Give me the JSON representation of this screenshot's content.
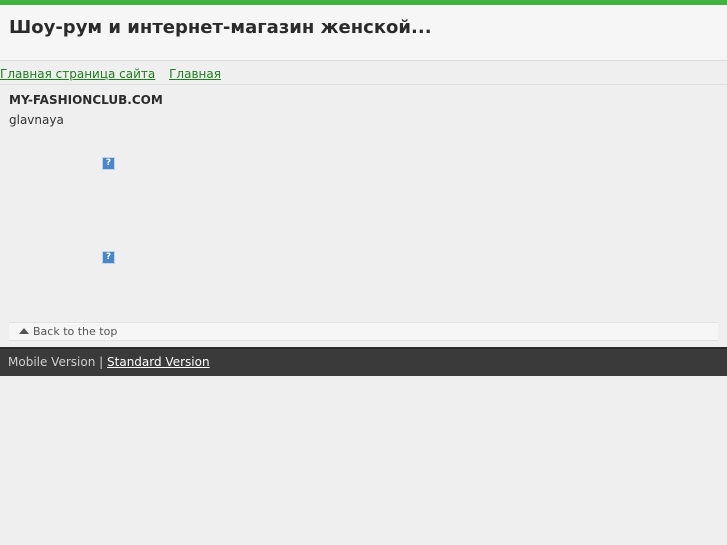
{
  "header": {
    "title": "Шоу-рум и интернет-магазин женской..."
  },
  "breadcrumb": {
    "items": [
      "Главная страница сайта",
      "Главная"
    ]
  },
  "content": {
    "site_name": "MY-FASHIONCLUB.COM",
    "subtitle": "glavnaya",
    "image_placeholder_glyph": "?"
  },
  "back_to_top": {
    "label": "Back to the top"
  },
  "footer": {
    "mobile_label": "Mobile Version",
    "separator": "|",
    "standard_label": "Standard Version"
  },
  "colors": {
    "accent": "#3fb23f",
    "link": "#1e7d1e",
    "footer_bg": "#3a3a3a"
  }
}
